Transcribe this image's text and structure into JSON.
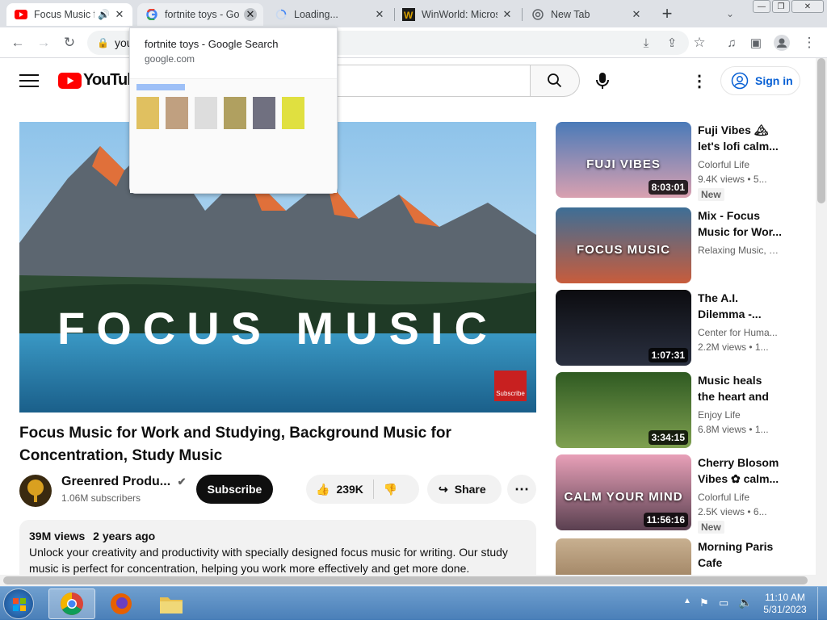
{
  "browser": {
    "tabs": [
      {
        "title": "Focus Music f",
        "favicon": "youtube-icon",
        "audio": true
      },
      {
        "title": "fortnite toys - Go",
        "favicon": "google-icon"
      },
      {
        "title": "Loading...",
        "favicon": "loading-spinner-icon"
      },
      {
        "title": "WinWorld: Micros",
        "favicon": "winworld-icon"
      },
      {
        "title": "New Tab",
        "favicon": "chrome-icon"
      }
    ],
    "url_partial": "you",
    "tooltip": {
      "title": "fortnite toys - Google Search",
      "domain": "google.com"
    }
  },
  "youtube": {
    "logo_text": "YouTube",
    "sign_in": "Sign in",
    "player_text": "FOCUS MUSIC",
    "watermark": "Subscribe",
    "video_title": "Focus Music for Work and Studying, Background Music for Concentration, Study Music",
    "channel_name": "Greenred Produ...",
    "subscribers": "1.06M subscribers",
    "subscribe_label": "Subscribe",
    "likes": "239K",
    "share_label": "Share",
    "views": "39M views",
    "age": "2 years ago",
    "description_line1": "Unlock your creativity and productivity with specially designed focus music for writing. Our study",
    "description_line2": "music is perfect for concentration, helping you work more effectively and get more done."
  },
  "recommendations": [
    {
      "title": "Fuji Vibes 🏔 let's lofi calm...",
      "channel": "Colorful Life",
      "meta": "9.4K views • 5...",
      "badge": "New",
      "duration": "8:03:01",
      "thumb_text": "FUJI VIBES",
      "colors": [
        "#4a7ab8",
        "#d9a0b0"
      ]
    },
    {
      "title": "Mix - Focus Music for Wor...",
      "channel": "Relaxing Music, Focus Music,...",
      "meta": "",
      "badge": "",
      "duration": "",
      "thumb_text": "FOCUS MUSIC",
      "colors": [
        "#3d6e96",
        "#c85c3c"
      ]
    },
    {
      "title": "The A.I. Dilemma -...",
      "channel": "Center for Huma...",
      "meta": "2.2M views • 1...",
      "badge": "",
      "duration": "1:07:31",
      "thumb_text": "",
      "colors": [
        "#0c0c10",
        "#2a3040"
      ]
    },
    {
      "title": "Music heals the heart and blo...",
      "channel": "Enjoy Life",
      "meta": "6.8M views • 1...",
      "badge": "",
      "duration": "3:34:15",
      "thumb_text": "",
      "colors": [
        "#2f5a22",
        "#7fa050"
      ]
    },
    {
      "title": "Cherry Blosom Vibes ✿ calm...",
      "channel": "Colorful Life",
      "meta": "2.5K views • 6...",
      "badge": "New",
      "duration": "11:56:16",
      "thumb_text": "CALM YOUR MIND",
      "colors": [
        "#e8a0b8",
        "#5a4050"
      ]
    },
    {
      "title": "Morning Paris Cafe Ambienc...",
      "channel": "",
      "meta": "",
      "badge": "",
      "duration": "",
      "thumb_text": "",
      "colors": [
        "#c8b090",
        "#806040"
      ]
    }
  ],
  "taskbar": {
    "time": "11:10 AM",
    "date": "5/31/2023"
  }
}
